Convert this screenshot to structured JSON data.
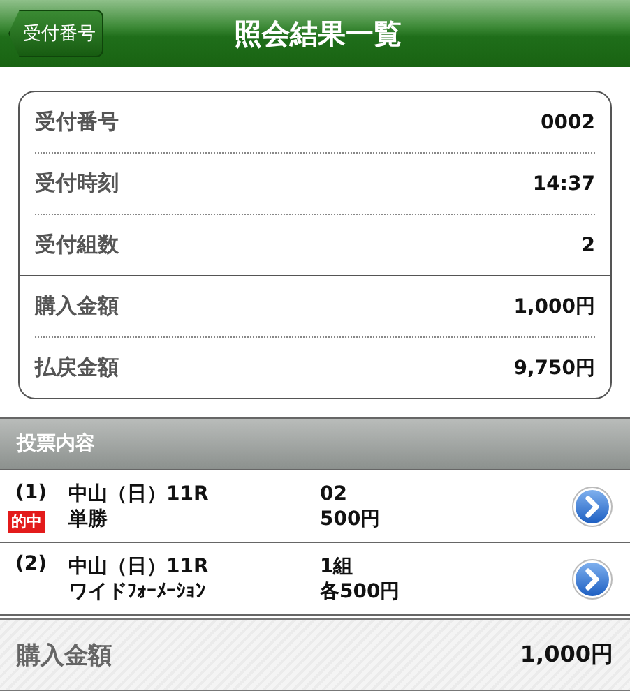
{
  "header": {
    "back_button": "受付番号",
    "title": "照会結果一覧"
  },
  "summary": [
    [
      {
        "label": "受付番号",
        "value": "0002"
      },
      {
        "label": "受付時刻",
        "value": "14:37"
      },
      {
        "label": "受付組数",
        "value": "2"
      }
    ],
    [
      {
        "label": "購入金額",
        "value": "1,000円"
      },
      {
        "label": "払戻金額",
        "value": "9,750円"
      }
    ]
  ],
  "section_title": "投票内容",
  "bets": [
    {
      "number": "(1)",
      "badge": "的中",
      "race": "中山（日）11R",
      "type": "単勝",
      "detail": "02",
      "amount": "500円"
    },
    {
      "number": "(2)",
      "race": "中山（日）11R",
      "type": "ワイドﾌｫｰﾒｰｼｮﾝ",
      "detail": "1組",
      "amount": "各500円"
    }
  ],
  "total": {
    "label": "購入金額",
    "value": "1,000円"
  }
}
